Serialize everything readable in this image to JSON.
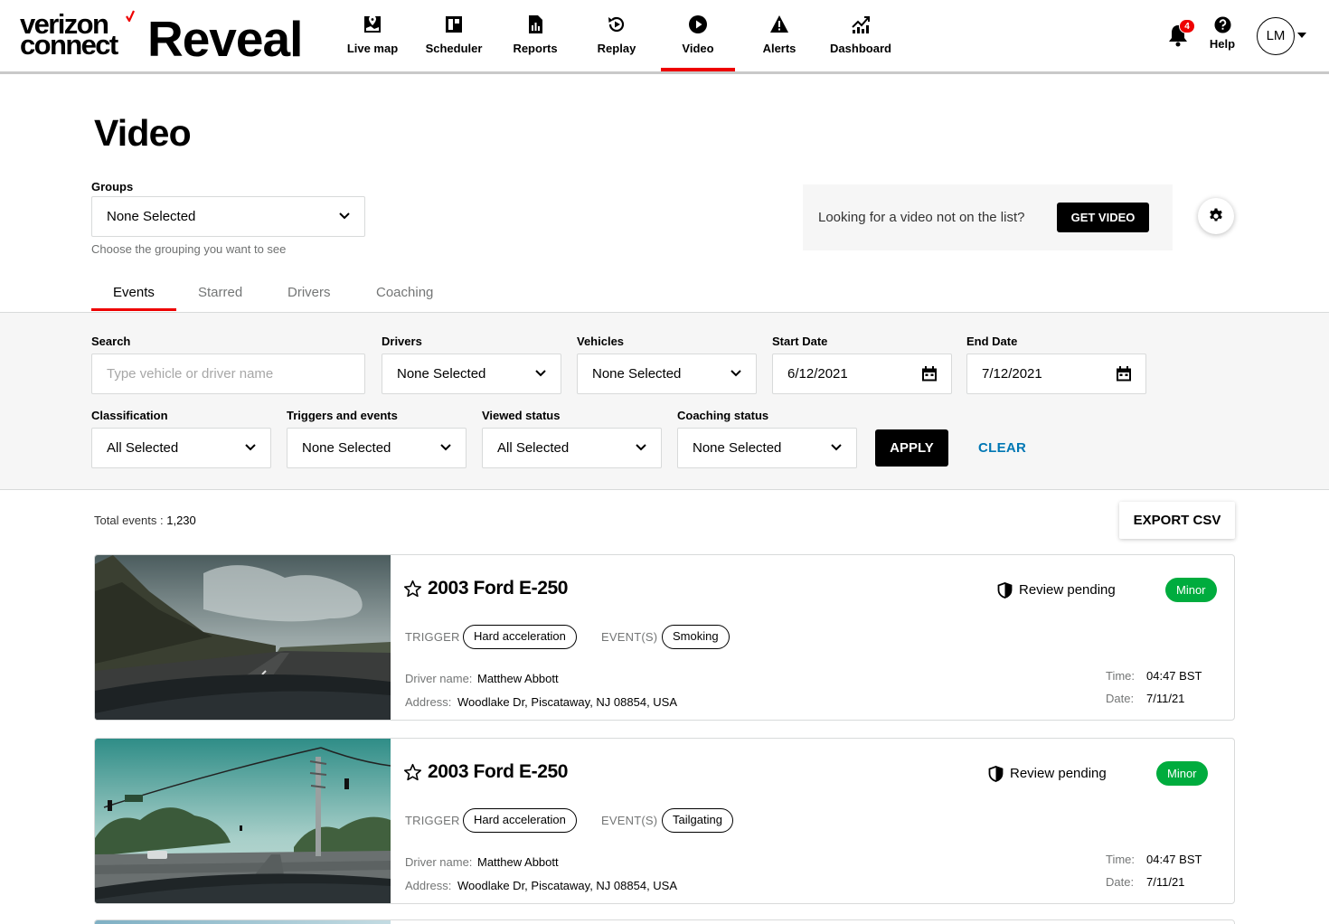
{
  "brand": {
    "line1": "verizon",
    "line2": "connect",
    "product": "Reveal",
    "accent_color": "#ee0000"
  },
  "nav": {
    "items": [
      {
        "label": "Live map",
        "icon": "map-pin-icon"
      },
      {
        "label": "Scheduler",
        "icon": "scheduler-icon"
      },
      {
        "label": "Reports",
        "icon": "report-icon"
      },
      {
        "label": "Replay",
        "icon": "replay-icon"
      },
      {
        "label": "Video",
        "icon": "play-icon",
        "active": true
      },
      {
        "label": "Alerts",
        "icon": "alert-icon"
      },
      {
        "label": "Dashboard",
        "icon": "dashboard-icon"
      }
    ],
    "notifications_count": "4",
    "help_label": "Help",
    "user_initials": "LM"
  },
  "page": {
    "title": "Video",
    "groups": {
      "label": "Groups",
      "value": "None Selected",
      "helper": "Choose the grouping you want to see"
    },
    "get_video": {
      "text": "Looking for a video not on the list?",
      "button": "GET VIDEO"
    }
  },
  "tabs": [
    {
      "label": "Events",
      "active": true
    },
    {
      "label": "Starred"
    },
    {
      "label": "Drivers"
    },
    {
      "label": "Coaching"
    }
  ],
  "filters": {
    "search": {
      "label": "Search",
      "placeholder": "Type vehicle or driver name",
      "value": ""
    },
    "drivers": {
      "label": "Drivers",
      "value": "None Selected"
    },
    "vehicles": {
      "label": "Vehicles",
      "value": "None Selected"
    },
    "start_date": {
      "label": "Start Date",
      "value": "6/12/2021"
    },
    "end_date": {
      "label": "End Date",
      "value": "7/12/2021"
    },
    "classification": {
      "label": "Classification",
      "value": "All Selected"
    },
    "triggers": {
      "label": "Triggers and events",
      "value": "None Selected"
    },
    "viewed": {
      "label": "Viewed status",
      "value": "All Selected"
    },
    "coaching": {
      "label": "Coaching status",
      "value": "None Selected"
    },
    "apply": "APPLY",
    "clear": "CLEAR"
  },
  "results": {
    "total_label": "Total events :",
    "total_value": "1,230",
    "export": "EXPORT CSV",
    "events": [
      {
        "vehicle": "2003 Ford E-250",
        "trigger_label": "TRIGGER",
        "trigger": "Hard acceleration",
        "events_label": "EVENT(S)",
        "event": "Smoking",
        "driver_label": "Driver name:",
        "driver": "Matthew Abbott",
        "address_label": "Address:",
        "address": "Woodlake Dr, Piscataway, NJ 08854, USA",
        "time_label": "Time:",
        "time": "04:47 BST",
        "date_label": "Date:",
        "date": "7/11/21",
        "review": "Review pending",
        "severity": "Minor",
        "severity_color": "#00ac3e"
      },
      {
        "vehicle": "2003 Ford E-250",
        "trigger_label": "TRIGGER",
        "trigger": "Hard acceleration",
        "events_label": "EVENT(S)",
        "event": "Tailgating",
        "driver_label": "Driver name:",
        "driver": "Matthew Abbott",
        "address_label": "Address:",
        "address": "Woodlake Dr, Piscataway, NJ 08854, USA",
        "time_label": "Time:",
        "time": "04:47 BST",
        "date_label": "Date:",
        "date": "7/11/21",
        "review": "Review pending",
        "severity": "Minor",
        "severity_color": "#00ac3e"
      }
    ]
  }
}
